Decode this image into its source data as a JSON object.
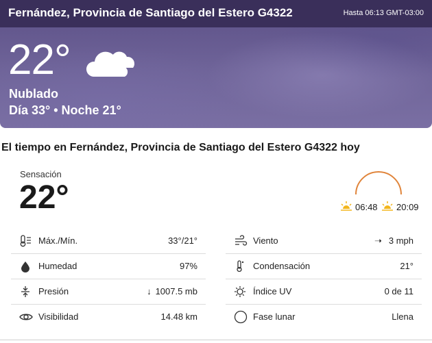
{
  "header": {
    "location": "Fernández, Provincia de Santiago del Estero G4322",
    "as_of": "Hasta 06:13 GMT-03:00"
  },
  "current": {
    "temperature": "22°",
    "phrase": "Nublado",
    "day_night": "Día 33° • Noche 21°",
    "condition_icon": "cloud-icon"
  },
  "today": {
    "title": "El tiempo en Fernández, Provincia de Santiago del Estero G4322 hoy",
    "feels_like_label": "Sensación",
    "feels_like_value": "22°",
    "sunrise": "06:48",
    "sunset": "20:09",
    "accent_color": "#e0843a"
  },
  "details_left": [
    {
      "icon": "thermometer-icon",
      "label": "Máx./Mín.",
      "value": "33°/21°"
    },
    {
      "icon": "humidity-drop-icon",
      "label": "Humedad",
      "value": "97%"
    },
    {
      "icon": "pressure-icon",
      "label": "Presión",
      "value": "1007.5 mb"
    },
    {
      "icon": "eye-icon",
      "label": "Visibilidad",
      "value": "14.48 km"
    }
  ],
  "details_right": [
    {
      "icon": "wind-icon",
      "label": "Viento",
      "value": "3 mph"
    },
    {
      "icon": "dew-point-icon",
      "label": "Condensación",
      "value": "21°"
    },
    {
      "icon": "uv-index-icon",
      "label": "Índice UV",
      "value": "0 de 11"
    },
    {
      "icon": "moon-phase-icon",
      "label": "Fase lunar",
      "value": "Llena"
    }
  ]
}
